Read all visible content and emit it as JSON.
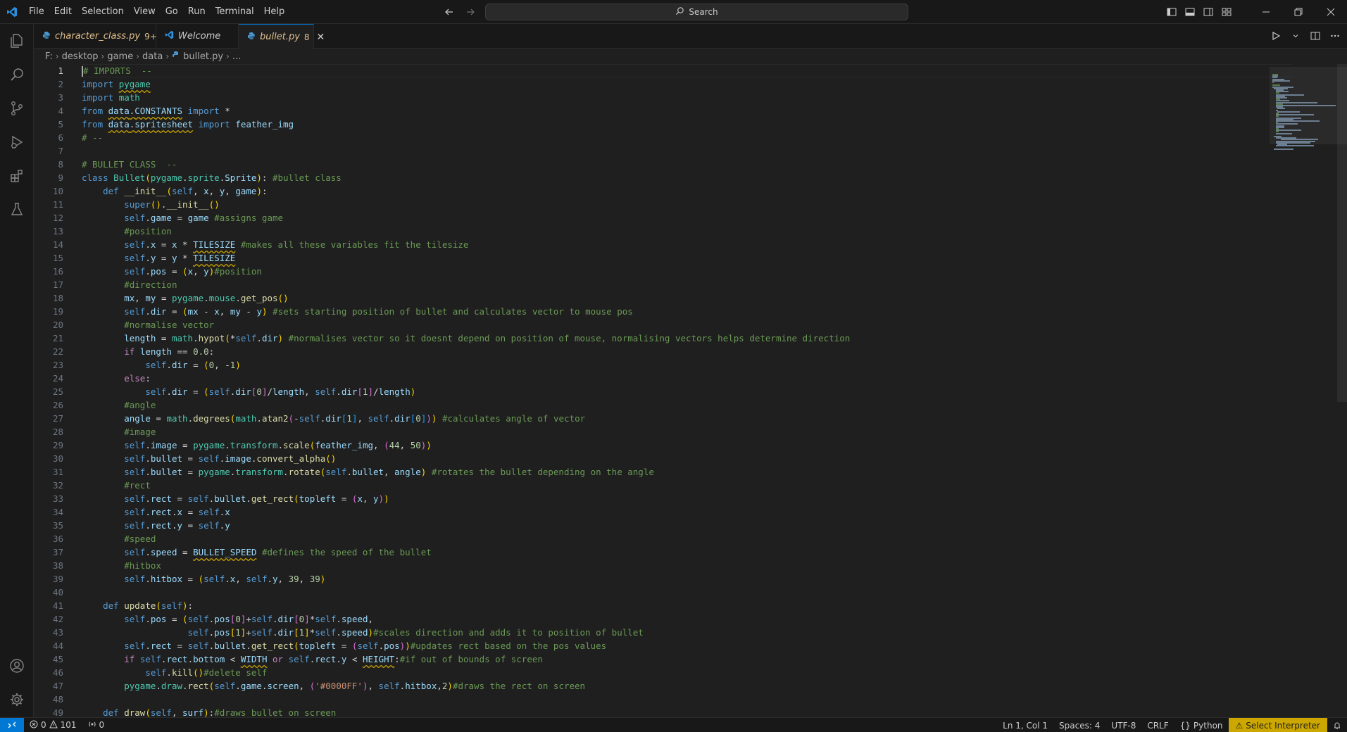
{
  "menu": [
    "File",
    "Edit",
    "Selection",
    "View",
    "Go",
    "Run",
    "Terminal",
    "Help"
  ],
  "search": {
    "label": "Search"
  },
  "tabs": [
    {
      "label": "character_class.py",
      "badge": "9+"
    },
    {
      "label": "Welcome",
      "badge": ""
    },
    {
      "label": "bullet.py",
      "badge": "8"
    }
  ],
  "breadcrumb": [
    "F:",
    "desktop",
    "game",
    "data",
    "bullet.py",
    "..."
  ],
  "editor": {
    "line_numbers": [
      "1",
      "2",
      "3",
      "4",
      "5",
      "6",
      "7",
      "8",
      "9",
      "10",
      "11",
      "12",
      "13",
      "14",
      "15",
      "16",
      "17",
      "18",
      "19",
      "20",
      "21",
      "22",
      "23",
      "24",
      "25",
      "26",
      "27",
      "28",
      "29",
      "30",
      "31",
      "32",
      "33",
      "34",
      "35",
      "36",
      "37",
      "38",
      "39",
      "40",
      "41",
      "42",
      "43",
      "44",
      "45",
      "46",
      "47",
      "48",
      "49"
    ],
    "lines": [
      "# IMPORTS  --",
      "import pygame",
      "import math",
      "from data.CONSTANTS import *",
      "from data.spritesheet import feather_img",
      "# --",
      "",
      "# BULLET CLASS  --",
      "class Bullet(pygame.sprite.Sprite): #bullet class",
      "    def __init__(self, x, y, game):",
      "        super().__init__()",
      "        self.game = game #assigns game",
      "        #position",
      "        self.x = x * TILESIZE #makes all these variables fit the tilesize",
      "        self.y = y * TILESIZE",
      "        self.pos = (x, y)#position",
      "        #direction",
      "        mx, my = pygame.mouse.get_pos()",
      "        self.dir = (mx - x, my - y) #sets starting position of bullet and calculates vector to mouse pos",
      "        #normalise vector",
      "        length = math.hypot(*self.dir) #normalises vector so it doesnt depend on position of mouse, normalising vectors helps determine direction",
      "        if length == 0.0:",
      "            self.dir = (0, -1)",
      "        else:",
      "            self.dir = (self.dir[0]/length, self.dir[1]/length)",
      "        #angle",
      "        angle = math.degrees(math.atan2(-self.dir[1], self.dir[0])) #calculates angle of vector",
      "        #image",
      "        self.image = pygame.transform.scale(feather_img, (44, 50))",
      "        self.bullet = self.image.convert_alpha()",
      "        self.bullet = pygame.transform.rotate(self.bullet, angle) #rotates the bullet depending on the angle",
      "        #rect",
      "        self.rect = self.bullet.get_rect(topleft = (x, y))",
      "        self.rect.x = self.x",
      "        self.rect.y = self.y",
      "        #speed",
      "        self.speed = BULLET_SPEED #defines the speed of the bullet",
      "        #hitbox",
      "        self.hitbox = (self.x, self.y, 39, 39)",
      "",
      "    def update(self):",
      "        self.pos = (self.pos[0]+self.dir[0]*self.speed,",
      "                    self.pos[1]+self.dir[1]*self.speed)#scales direction and adds it to position of bullet",
      "        self.rect = self.bullet.get_rect(topleft = (self.pos))#updates rect based on the pos values",
      "        if self.rect.bottom < WIDTH or self.rect.y < HEIGHT:#if out of bounds of screen",
      "            self.kill()#delete self",
      "        pygame.draw.rect(self.game.screen, ('#0000FF'), self.hitbox,2)#draws the rect on screen",
      "",
      "    def draw(self, surf):#draws bullet on screen"
    ]
  },
  "status": {
    "errors": "0",
    "warnings": "101",
    "ports": "0",
    "position": "Ln 1, Col 1",
    "spaces": "Spaces: 4",
    "encoding": "UTF-8",
    "eol": "CRLF",
    "language": "Python",
    "interpreter": "Select Interpreter"
  },
  "colors": {
    "accent": "#0078d4",
    "warning": "#cca700",
    "modified_tab": "#e2c08d"
  },
  "icons": [
    "vscode-logo-icon",
    "explorer-icon",
    "search-icon",
    "source-control-icon",
    "run-debug-icon",
    "extensions-icon",
    "testing-icon",
    "account-icon",
    "manage-gear-icon",
    "python-file-icon",
    "vscode-welcome-icon"
  ]
}
